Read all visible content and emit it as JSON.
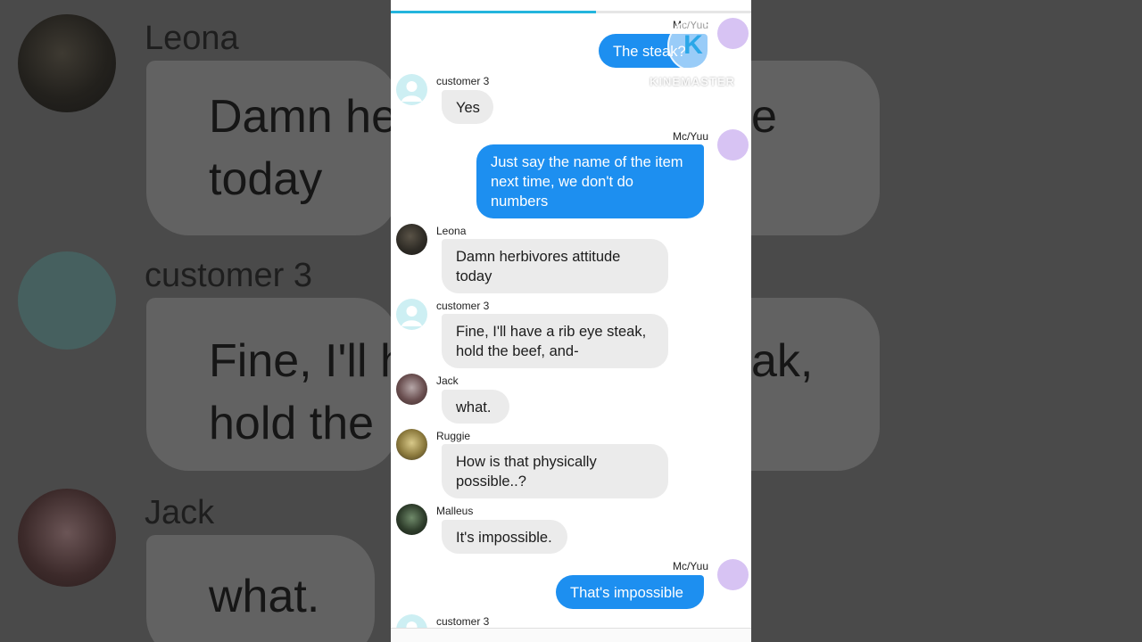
{
  "background": {
    "blocks": [
      {
        "name": "Leona",
        "lines": [
          "Damn he",
          "today"
        ]
      },
      {
        "name": "customer 3",
        "lines": [
          "Fine, I'll h",
          "hold the"
        ],
        "right_fragment": "ak,"
      },
      {
        "name": "Jack",
        "lines": [
          "what."
        ]
      }
    ],
    "right_fragment_top": "e"
  },
  "progress": {
    "value": 0.57
  },
  "messages": [
    {
      "sender": "Mc/Yuu",
      "text": "The steak?",
      "side": "right"
    },
    {
      "sender": "customer 3",
      "text": "Yes",
      "side": "left"
    },
    {
      "sender": "Mc/Yuu",
      "text": "Just say the name of the item next time, we don't do numbers",
      "side": "right"
    },
    {
      "sender": "Leona",
      "text": "Damn herbivores attitude today",
      "side": "left"
    },
    {
      "sender": "customer 3",
      "text": "Fine, I'll have a rib eye steak, hold the beef, and-",
      "side": "left"
    },
    {
      "sender": "Jack",
      "text": "what.",
      "side": "left"
    },
    {
      "sender": "Ruggie",
      "text": "How is that physically possible..?",
      "side": "left"
    },
    {
      "sender": "Malleus",
      "text": "It's impossible.",
      "side": "left"
    },
    {
      "sender": "Mc/Yuu",
      "text": "That's impossible",
      "side": "right"
    },
    {
      "sender": "customer 3",
      "text": "",
      "side": "left"
    }
  ],
  "watermark": {
    "logo": "K",
    "text": "KINEMASTER"
  },
  "colors": {
    "outgoing": "#1d8ff0",
    "incoming": "#ebebeb",
    "progress": "#23b5dd",
    "self_avatar": "#d7c3f3",
    "default_avatar": "#cdeff3"
  },
  "icons": {
    "default_avatar": "person-silhouette-icon"
  }
}
